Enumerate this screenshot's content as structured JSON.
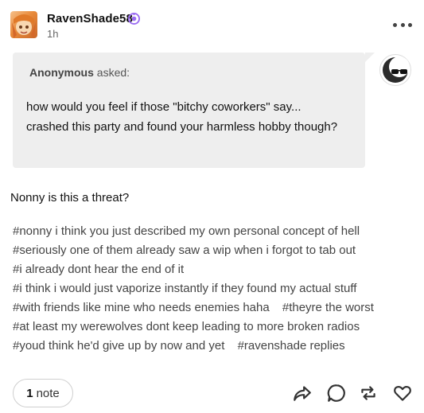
{
  "post": {
    "username": "RavenShade58",
    "timestamp": "1h",
    "ask": {
      "asker": "Anonymous",
      "asked_label": "asked:",
      "question": "how would you feel if those \"bitchy coworkers\" say... crashed this party and found your harmless hobby though?"
    },
    "answer": "Nonny is this a threat?",
    "tag_lines": [
      [
        "#nonny i think you just described my own personal concept of hell"
      ],
      [
        "#seriously one of them already saw a wip when i forgot to tab out"
      ],
      [
        "#i already dont hear the end of it"
      ],
      [
        "#i think i would just vaporize instantly if they found my actual stuff"
      ],
      [
        "#with friends like mine who needs enemies haha",
        "#theyre the worst"
      ],
      [
        "#at least my werewolves dont keep leading to more broken radios"
      ],
      [
        "#youd think he'd give up by now and yet",
        "#ravenshade replies"
      ]
    ],
    "notes": {
      "count": "1",
      "label": "note"
    }
  },
  "colors": {
    "ask_bg": "#eeeeee",
    "badge": "#9b6cf2",
    "tag_text": "#444444"
  }
}
